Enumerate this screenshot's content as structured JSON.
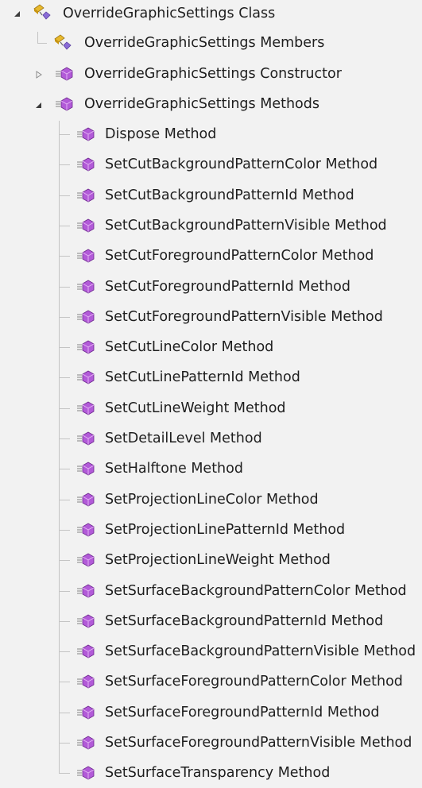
{
  "tree": {
    "root": {
      "label": "OverrideGraphicSettings Class",
      "icon": "class-icon",
      "expanded": true
    },
    "members": {
      "label": "OverrideGraphicSettings Members",
      "icon": "class-members-icon"
    },
    "constructor": {
      "label": "OverrideGraphicSettings Constructor",
      "icon": "method-icon",
      "expanded": false
    },
    "methods": {
      "label": "OverrideGraphicSettings Methods",
      "icon": "method-icon",
      "expanded": true
    },
    "method_items": [
      "Dispose Method",
      "SetCutBackgroundPatternColor Method",
      "SetCutBackgroundPatternId Method",
      "SetCutBackgroundPatternVisible Method",
      "SetCutForegroundPatternColor Method",
      "SetCutForegroundPatternId Method",
      "SetCutForegroundPatternVisible Method",
      "SetCutLineColor Method",
      "SetCutLinePatternId Method",
      "SetCutLineWeight Method",
      "SetDetailLevel Method",
      "SetHalftone Method",
      "SetProjectionLineColor Method",
      "SetProjectionLinePatternId Method",
      "SetProjectionLineWeight Method",
      "SetSurfaceBackgroundPatternColor Method",
      "SetSurfaceBackgroundPatternId Method",
      "SetSurfaceBackgroundPatternVisible Method",
      "SetSurfaceForegroundPatternColor Method",
      "SetSurfaceForegroundPatternId Method",
      "SetSurfaceForegroundPatternVisible Method",
      "SetSurfaceTransparency Method"
    ]
  },
  "colors": {
    "background": "#f2f2f2",
    "text": "#1e1e1e",
    "connector": "#c4c4c4",
    "method_icon": "#b25ad8",
    "class_icon": "#e8b92d"
  }
}
